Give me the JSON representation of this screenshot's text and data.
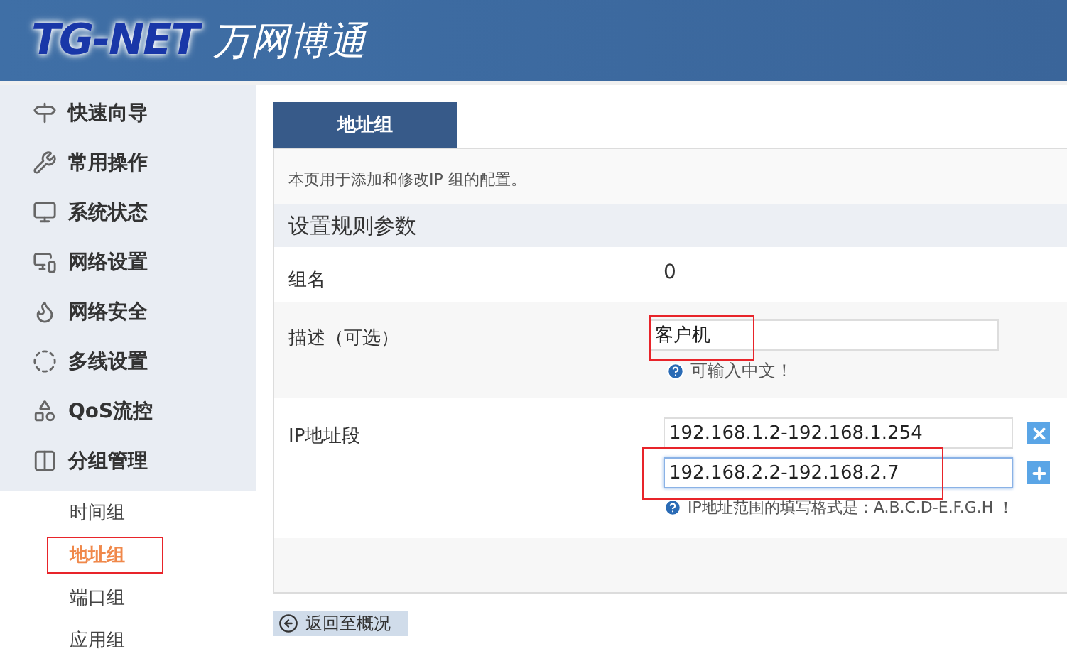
{
  "header": {
    "logo_latin": "TG-NET",
    "logo_cjk": "万网博通"
  },
  "sidebar": {
    "items": [
      {
        "label": "快速向导",
        "kind": "signpost"
      },
      {
        "label": "常用操作",
        "kind": "wrench"
      },
      {
        "label": "系统状态",
        "kind": "monitor"
      },
      {
        "label": "网络设置",
        "kind": "code"
      },
      {
        "label": "网络安全",
        "kind": "firewall"
      },
      {
        "label": "多线设置",
        "kind": "ring"
      },
      {
        "label": "QoS流控",
        "kind": "blocks"
      },
      {
        "label": "分组管理",
        "kind": "binders",
        "children": [
          {
            "label": "时间组",
            "selected": false,
            "highlighted": false
          },
          {
            "label": "地址组",
            "selected": true,
            "highlighted": true
          },
          {
            "label": "端口组",
            "selected": false,
            "highlighted": false
          },
          {
            "label": "应用组",
            "selected": false,
            "highlighted": false
          }
        ]
      }
    ]
  },
  "tabs": [
    {
      "label": "地址组",
      "selected": true
    }
  ],
  "intro": "本页用于添加和修改IP 组的配置。",
  "section_title": "设置规则参数",
  "form": {
    "group_name": {
      "label": "组名",
      "value": "0"
    },
    "description": {
      "label": "描述（可选）",
      "value": "客户机",
      "hint": "可输入中文！",
      "highlighted": true
    },
    "ip_ranges": {
      "label": "IP地址段",
      "hint": "IP地址范围的填写格式是：A.B.C.D-E.F.G.H ！",
      "items": [
        {
          "value": "192.168.1.2-192.168.1.254",
          "kind": "remove",
          "focused": false,
          "highlighted": false
        },
        {
          "value": "192.168.2.2-192.168.2.7",
          "kind": "add",
          "focused": true,
          "highlighted": true
        }
      ]
    }
  },
  "back_link": "返回至概况"
}
